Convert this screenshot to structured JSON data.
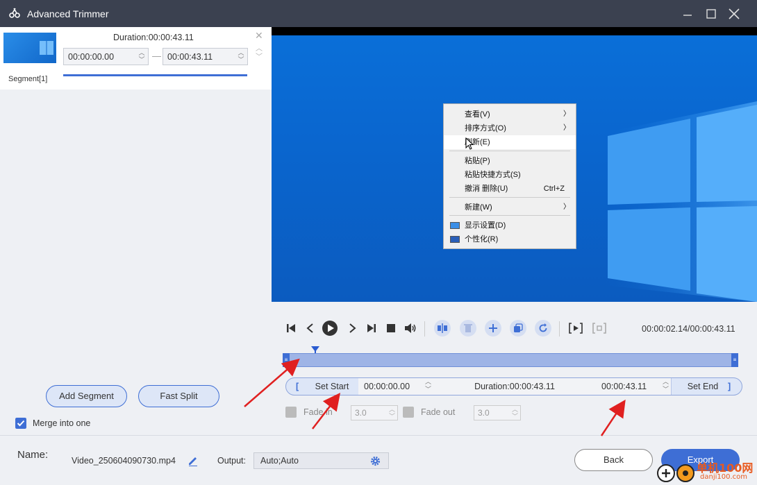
{
  "window": {
    "title": "Advanced Trimmer",
    "minimize_icon": "minimize-icon",
    "maximize_icon": "maximize-icon",
    "close_icon": "close-icon"
  },
  "segment": {
    "duration": "Duration:00:00:43.11",
    "start": "00:00:00.00",
    "end": "00:00:43.11",
    "label": "Segment[1]"
  },
  "left_panel": {
    "add_segment": "Add Segment",
    "fast_split": "Fast Split",
    "merge_label": "Merge into one",
    "merge_checked": true
  },
  "context_menu": {
    "items": [
      {
        "label": "查看(V)",
        "shortcut": "",
        "submenu": true
      },
      {
        "label": "排序方式(O)",
        "shortcut": "",
        "submenu": true
      },
      {
        "label": "刷新(E)",
        "shortcut": "",
        "submenu": false
      },
      {
        "label": "粘贴(P)",
        "shortcut": "",
        "submenu": false
      },
      {
        "label": "粘贴快捷方式(S)",
        "shortcut": "",
        "submenu": false
      },
      {
        "label": "撤消 删除(U)",
        "shortcut": "Ctrl+Z",
        "submenu": false
      },
      {
        "label": "新建(W)",
        "shortcut": "",
        "submenu": true
      },
      {
        "label": "显示设置(D)",
        "shortcut": "",
        "submenu": false
      },
      {
        "label": "个性化(R)",
        "shortcut": "",
        "submenu": false
      }
    ]
  },
  "player": {
    "timecode": "00:00:02.14/00:00:43.11",
    "playhead_fraction": 0.05
  },
  "trim": {
    "set_start": "Set Start",
    "start_time": "00:00:00.00",
    "duration": "Duration:00:00:43.11",
    "end_time": "00:00:43.11",
    "set_end": "Set End",
    "start_bracket": "[",
    "end_bracket": "]"
  },
  "fade": {
    "fade_in_label": "Fade in",
    "fade_in_value": "3.0",
    "fade_out_label": "Fade out",
    "fade_out_value": "3.0"
  },
  "bottom": {
    "name_label": "Name:",
    "file_name": "Video_250604090730.mp4",
    "output_label": "Output:",
    "output_value": "Auto;Auto",
    "back": "Back",
    "export": "Export"
  },
  "watermark": {
    "text": "单机100网",
    "url": "danji100.com"
  },
  "colors": {
    "accent": "#3e6ed5",
    "titlebar": "#3b4150",
    "annotation_arrow": "#e02020"
  }
}
